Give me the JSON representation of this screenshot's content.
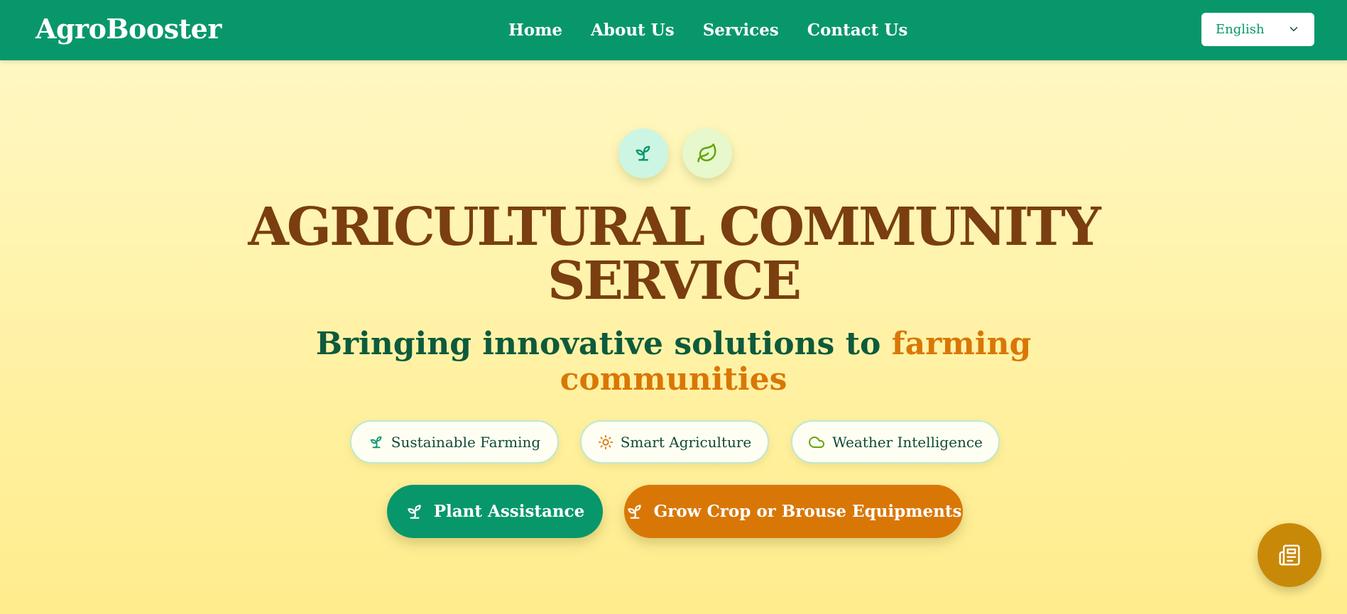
{
  "header": {
    "brand": "AgroBooster",
    "nav": [
      "Home",
      "About Us",
      "Services",
      "Contact Us"
    ],
    "language": "English"
  },
  "hero": {
    "icons": [
      "sprout-icon",
      "leaf-icon"
    ],
    "title_line1": "AGRICULTURAL COMMUNITY",
    "title_line2": "SERVICE",
    "subtitle_part1": "Bringing innovative solutions to",
    "subtitle_part2": "farming",
    "subtitle_part3": "communities",
    "features": [
      {
        "label": "Sustainable Farming",
        "icon": "sprout-icon"
      },
      {
        "label": "Smart Agriculture",
        "icon": "sun-icon"
      },
      {
        "label": "Weather Intelligence",
        "icon": "cloud-icon"
      }
    ],
    "cta_primary": "Plant Assistance",
    "cta_secondary": "Grow Crop or Brouse Equipments"
  },
  "fab": {
    "icon": "newspaper-icon"
  },
  "colors": {
    "header": "#08976b",
    "title": "#7a3e10",
    "subtitle_green": "#0d5a3c",
    "accent_orange": "#d97706",
    "fab": "#c98908"
  }
}
